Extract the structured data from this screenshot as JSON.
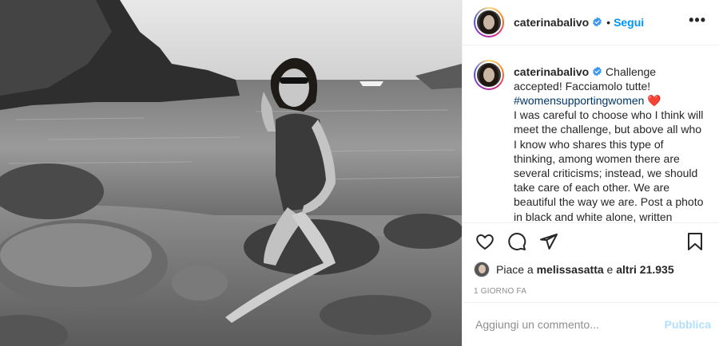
{
  "header": {
    "username": "caterinabalivo",
    "separator": "•",
    "follow_label": "Segui",
    "more_label": "•••"
  },
  "icons": {
    "verified": "verified-badge-icon",
    "like": "heart-icon",
    "comment": "comment-icon",
    "share": "paper-plane-icon",
    "save": "bookmark-icon",
    "more": "more-options-icon"
  },
  "caption": {
    "username": "caterinabalivo",
    "line1": "Challenge accepted! Facciamolo tutte!",
    "hashtag": "#womensupportingwomen",
    "heart": "❤️",
    "body": "I was careful to choose who I think will meet the challenge, but above all who I know who shares this type of thinking, among women there are several criticisms; instead, we should take care of each other. We are beautiful the way we are. Post a photo in black and white alone, written"
  },
  "likes": {
    "prefix": "Piace a",
    "user": "melissasatta",
    "conjunction": "e",
    "others": "altri 21.935"
  },
  "timestamp": "1 GIORNO FA",
  "comment": {
    "placeholder": "Aggiungi un commento...",
    "publish_label": "Pubblica"
  },
  "colors": {
    "accent": "#0095f6",
    "publish_disabled": "#b2dffc",
    "hashtag": "#00376b",
    "heart": "#ed4956"
  }
}
